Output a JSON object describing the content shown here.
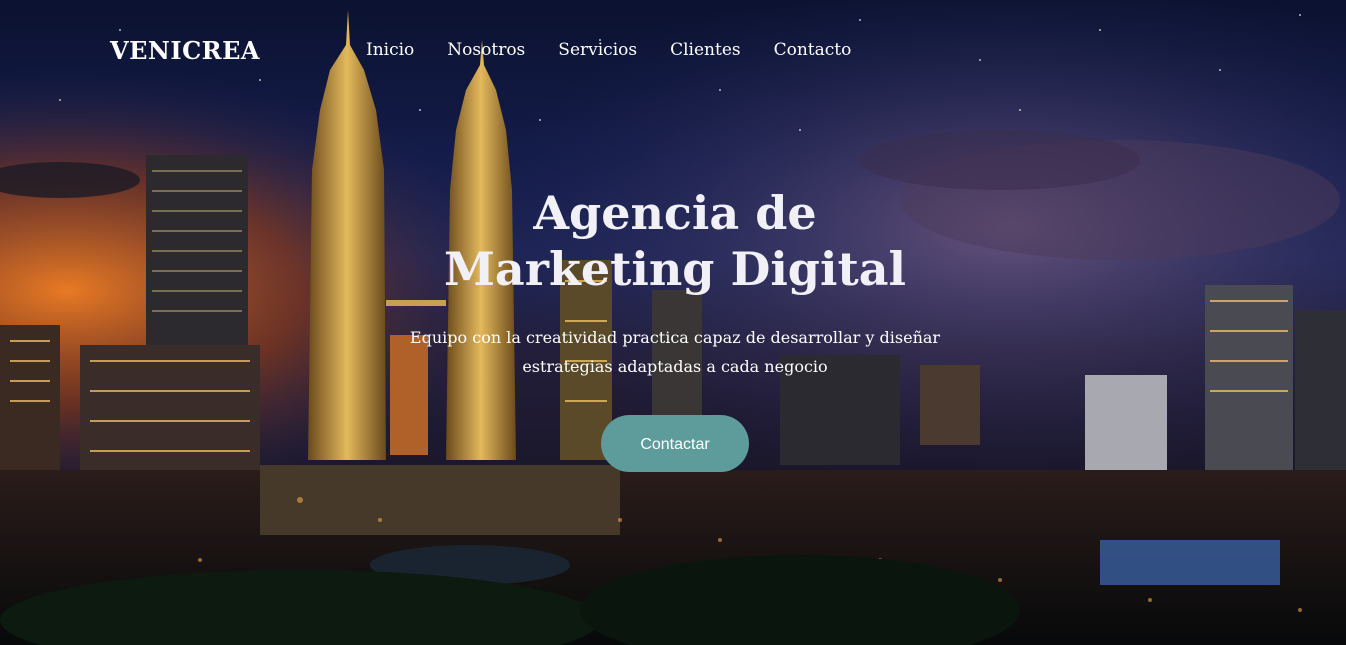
{
  "brand": {
    "name": "VENICREA"
  },
  "nav": {
    "items": [
      {
        "label": "Inicio"
      },
      {
        "label": "Nosotros"
      },
      {
        "label": "Servicios"
      },
      {
        "label": "Clientes"
      },
      {
        "label": "Contacto"
      }
    ]
  },
  "hero": {
    "title": "Agencia de Marketing Digital",
    "subtitle": "Equipo con la creatividad practica capaz de desarrollar y diseñar estrategias adaptadas a cada negocio",
    "cta_label": "Contactar",
    "background_image": "night-city-skyline"
  },
  "colors": {
    "cta": "#5e9b9b",
    "text": "#ffffff",
    "sky_top": "#0b1230",
    "sunset": "#d8641f"
  }
}
